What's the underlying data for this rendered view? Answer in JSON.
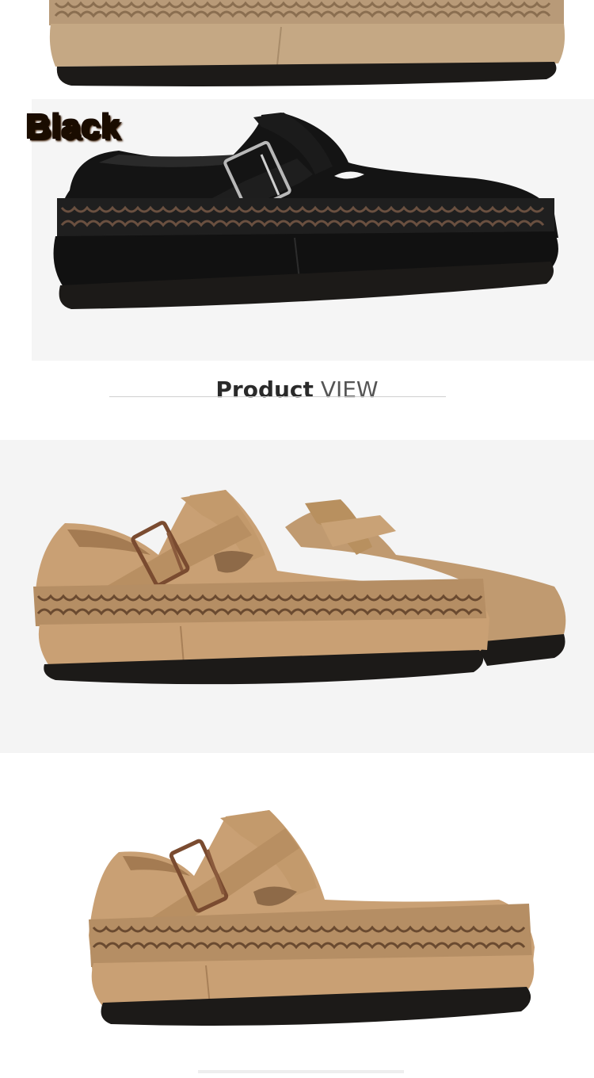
{
  "color_label": "Black",
  "section": {
    "title_bold": "Product",
    "title_light": "VIEW"
  },
  "colors": {
    "tan_suede": "#c9a074",
    "black_suede": "#141414",
    "sole": "#1c1a18",
    "buckle": "#8a5a3c",
    "label_orange": "#e07a1e"
  }
}
